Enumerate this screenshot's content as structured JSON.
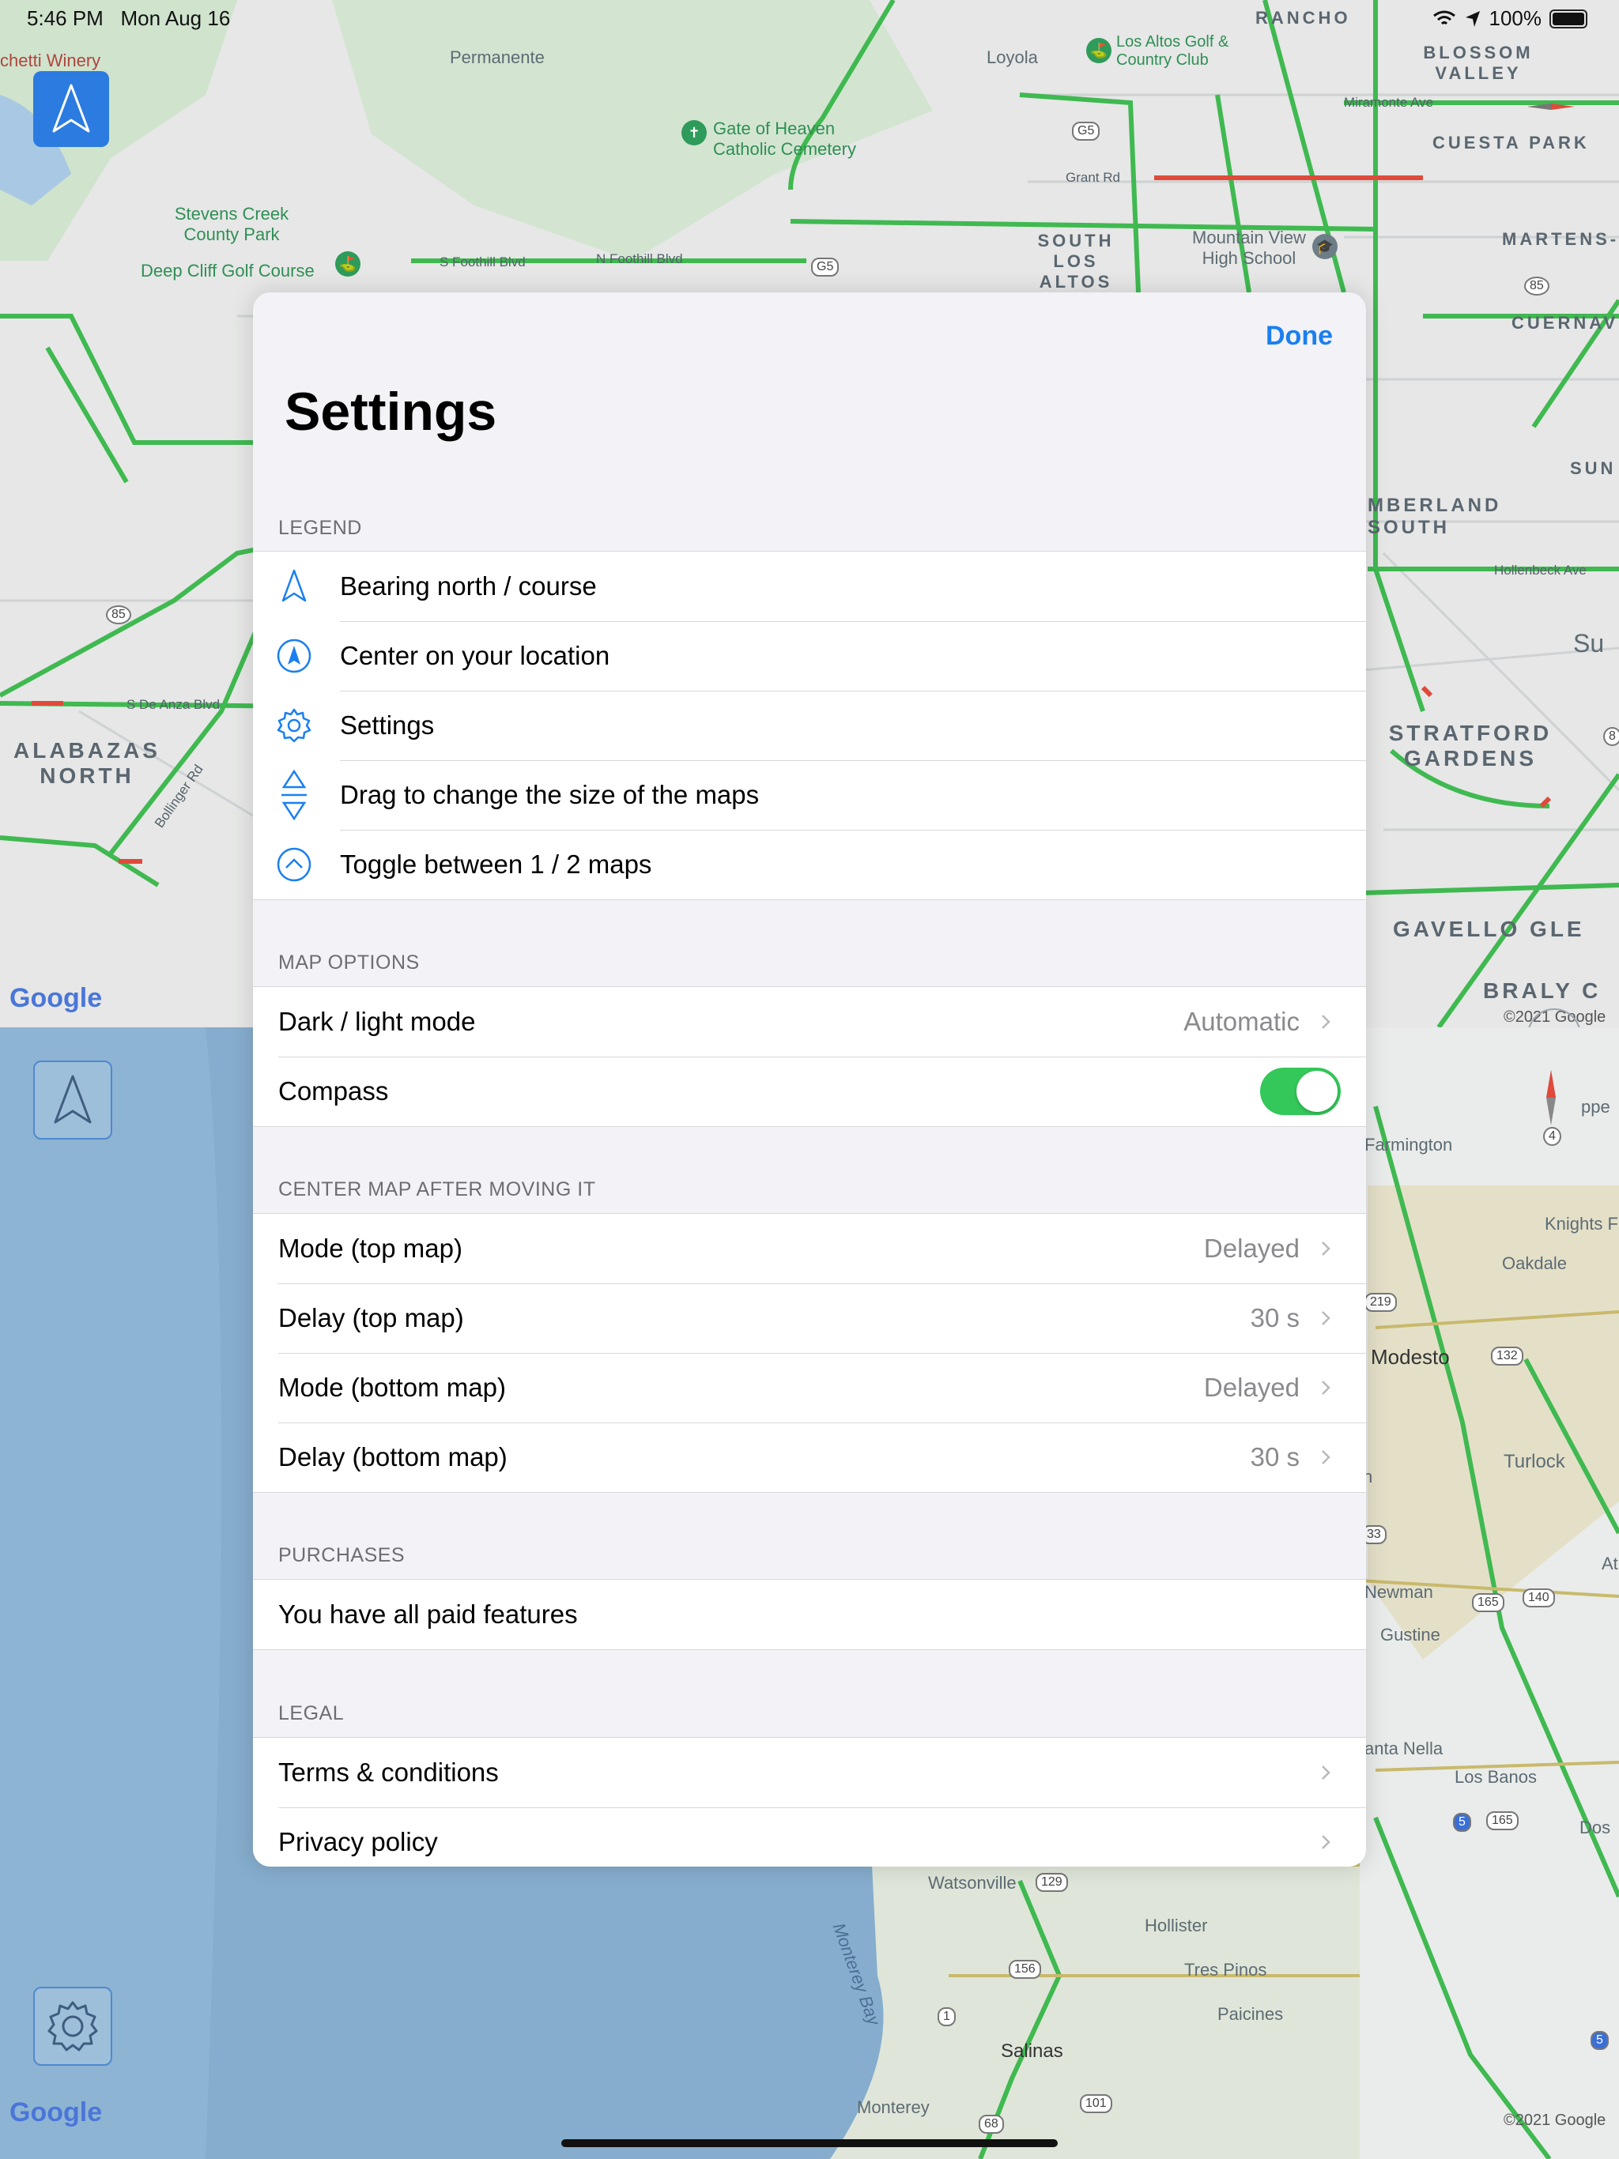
{
  "status_bar": {
    "time": "5:46 PM",
    "date": "Mon Aug 16",
    "battery": "100%"
  },
  "map_top": {
    "labels": {
      "winery": "chetti Winery",
      "permanente": "Permanente",
      "loyola": "Loyola",
      "los_altos_golf": "Los Altos Golf & Country Club",
      "rancho": "RANCHO",
      "blossom_valley": "BLOSSOM VALLEY",
      "gate_of_heaven": "Gate of Heaven Catholic Cemetery",
      "miramonte": "Miramonte Ave",
      "cuesta_park": "CUESTA PARK",
      "grant_rd": "Grant Rd",
      "stevens_creek": "Stevens Creek County Park",
      "south_los_altos": "SOUTH LOS ALTOS",
      "mountain_view_hs": "Mountain View High School",
      "martens": "MARTENS-CA",
      "deep_cliff": "Deep Cliff Golf Course",
      "s_foothill": "S Foothill Blvd",
      "n_foothill": "N Foothill Blvd",
      "cuernav": "CUERNAV",
      "sun": "SUN",
      "cumberland_south": "MBERLAND SOUTH",
      "hollenbeck": "Hollenbeck Ave",
      "su": "Su",
      "de_anza": "S De Anza Blvd",
      "calabazas_north": "ALABAZAS NORTH",
      "bollinger": "Bollinger Rd",
      "stratford_gardens": "STRATFORD GARDENS",
      "gavello": "GAVELLO GLE",
      "braly": "BRALY C"
    },
    "shields": {
      "g5a": "G5",
      "g5b": "G5",
      "r85a": "85",
      "r85b": "85",
      "r8": "8"
    },
    "google": "Google",
    "copyright": "©2021 Google"
  },
  "map_bottom": {
    "labels": {
      "farmington": "Farmington",
      "knights": "Knights F",
      "oakdale": "Oakdale",
      "modesto": "Modesto",
      "turlock": "Turlock",
      "newman": "Newman",
      "gustine": "Gustine",
      "santa_nella": "anta Nella",
      "los_banos": "Los Banos",
      "dos": "Dos",
      "ppe": "ppe",
      "n": "n",
      "at": "At",
      "watsonville": "Watsonville",
      "hollister": "Hollister",
      "tres_pinos": "Tres Pinos",
      "paicines": "Paicines",
      "monterey_bay": "Monterey Bay",
      "salinas": "Salinas",
      "monterey": "Monterey"
    },
    "shields": {
      "r4": "4",
      "r219": "219",
      "r132": "132",
      "r33": "33",
      "r165a": "165",
      "r140": "140",
      "r5a": "5",
      "r165b": "165",
      "r129": "129",
      "r156": "156",
      "r1": "1",
      "r68": "68",
      "r101": "101",
      "r5b": "5"
    },
    "google": "Google",
    "copyright": "©2021 Google"
  },
  "settings": {
    "done": "Done",
    "title": "Settings",
    "legend": {
      "header": "LEGEND",
      "items": [
        {
          "icon": "bearing-north-icon",
          "label": "Bearing north / course"
        },
        {
          "icon": "center-location-icon",
          "label": "Center on your location"
        },
        {
          "icon": "gear-icon",
          "label": "Settings"
        },
        {
          "icon": "resize-drag-icon",
          "label": "Drag to change the size of the maps"
        },
        {
          "icon": "chevron-up-circle-icon",
          "label": "Toggle between 1 / 2 maps"
        }
      ]
    },
    "map_options": {
      "header": "MAP OPTIONS",
      "dark_light": {
        "label": "Dark / light mode",
        "value": "Automatic"
      },
      "compass": {
        "label": "Compass",
        "on": true
      }
    },
    "center_map": {
      "header": "CENTER MAP AFTER MOVING IT",
      "rows": [
        {
          "label": "Mode (top map)",
          "value": "Delayed"
        },
        {
          "label": "Delay (top map)",
          "value": "30 s"
        },
        {
          "label": "Mode (bottom map)",
          "value": "Delayed"
        },
        {
          "label": "Delay (bottom map)",
          "value": "30 s"
        }
      ]
    },
    "purchases": {
      "header": "PURCHASES",
      "label": "You have all paid features"
    },
    "legal": {
      "header": "LEGAL",
      "terms": "Terms & conditions",
      "privacy": "Privacy policy"
    }
  },
  "colors": {
    "accent": "#1a7ff0",
    "toggle_on": "#34c759",
    "traffic_green": "#3fb950",
    "traffic_red": "#e04a3a",
    "water": "#87aecd"
  }
}
